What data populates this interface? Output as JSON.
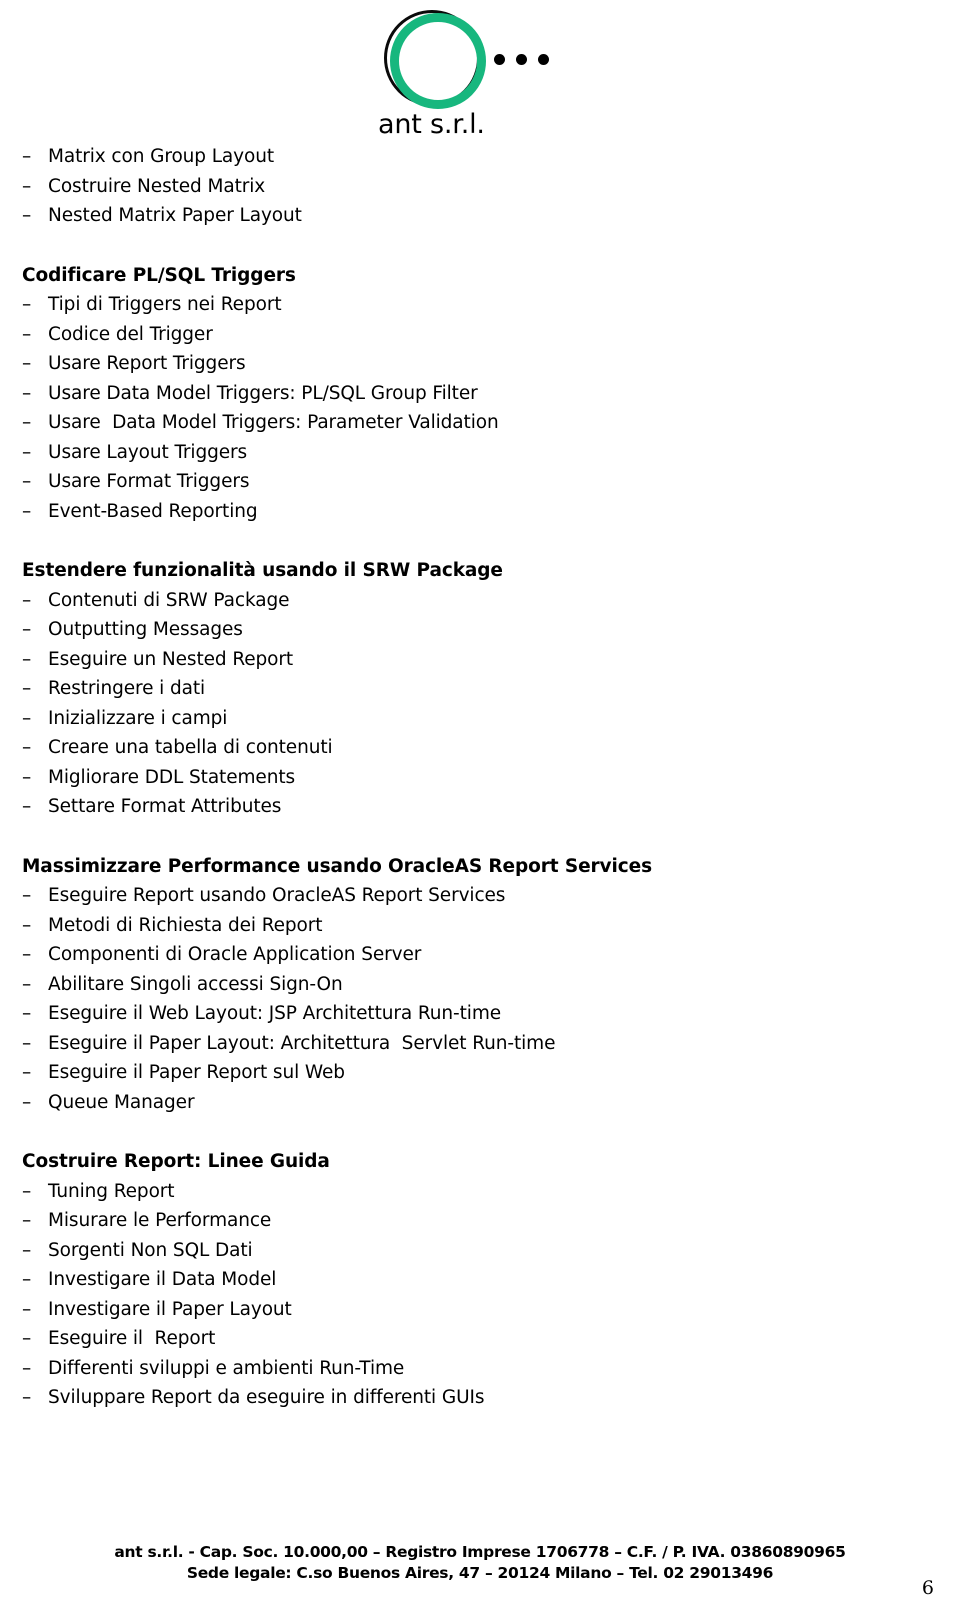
{
  "logo": {
    "company_name": "ant s.r.l.",
    "ring_color_outer": "#17b77e",
    "ring_color_inner": "#0a0a0a",
    "dot_color": "#000000",
    "dot_count": 3
  },
  "document": {
    "page_number": "6",
    "intro_items": [
      "Matrix con Group Layout",
      "Costruire Nested Matrix",
      "Nested Matrix Paper Layout"
    ],
    "sections": [
      {
        "heading": "Codificare PL/SQL Triggers",
        "items": [
          "Tipi di Triggers nei Report",
          "Codice del Trigger",
          "Usare Report Triggers",
          "Usare Data Model Triggers: PL/SQL Group Filter",
          "Usare  Data Model Triggers: Parameter Validation",
          "Usare Layout Triggers",
          "Usare Format Triggers",
          "Event-Based Reporting"
        ]
      },
      {
        "heading": "Estendere funzionalità usando il SRW Package",
        "items": [
          "Contenuti di SRW Package",
          "Outputting Messages",
          "Eseguire un Nested Report",
          "Restringere i dati",
          "Inizializzare i campi",
          "Creare una tabella di contenuti",
          "Migliorare DDL Statements",
          "Settare Format Attributes"
        ]
      },
      {
        "heading": "Massimizzare Performance usando OracleAS Report Services",
        "items": [
          "Eseguire Report usando OracleAS Report Services",
          "Metodi di Richiesta dei Report",
          "Componenti di Oracle Application Server",
          "Abilitare Singoli accessi Sign-On",
          "Eseguire il Web Layout: JSP Architettura Run-time",
          "Eseguire il Paper Layout: Architettura  Servlet Run-time",
          "Eseguire il Paper Report sul Web",
          "Queue Manager"
        ]
      },
      {
        "heading": "Costruire Report: Linee Guida",
        "items": [
          "Tuning Report",
          "Misurare le Performance",
          "Sorgenti Non SQL Dati",
          "Investigare il Data Model",
          "Investigare il Paper Layout",
          "Eseguire il  Report",
          "Differenti sviluppi e ambienti Run-Time",
          "Sviluppare Report da eseguire in differenti GUIs"
        ]
      }
    ],
    "bullet_marker": "–"
  },
  "footer": {
    "line1": "ant s.r.l. - Cap. Soc. 10.000,00 – Registro Imprese 1706778 – C.F. / P. IVA. 03860890965",
    "line2": "Sede legale: C.so Buenos Aires, 47 – 20124 Milano – Tel. 02 29013496"
  }
}
